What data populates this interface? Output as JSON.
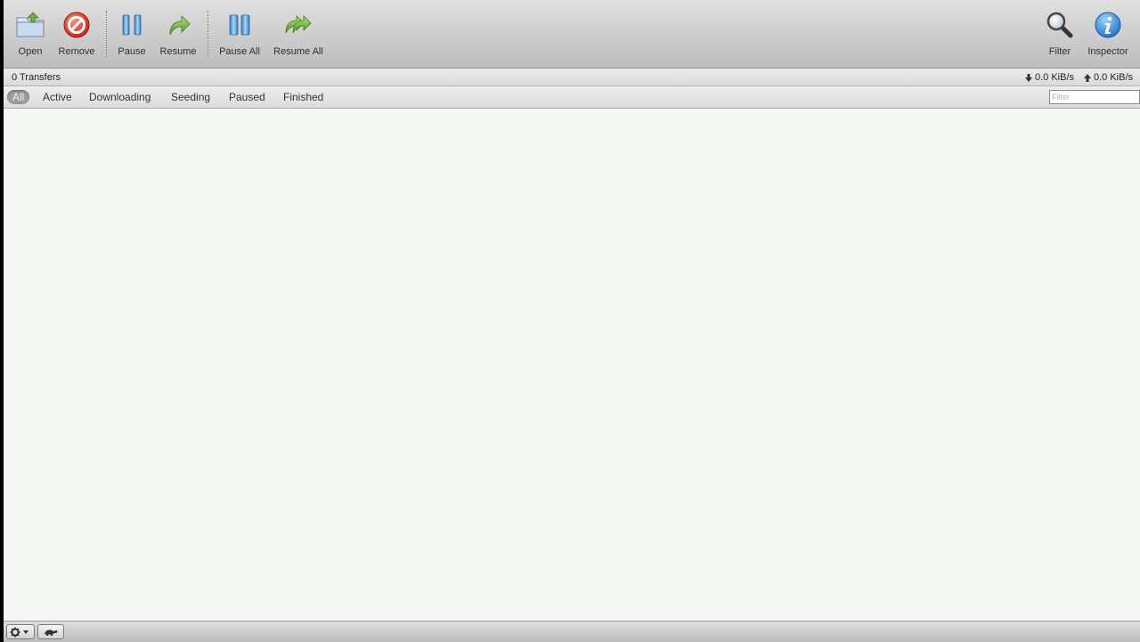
{
  "toolbar": {
    "open_label": "Open",
    "remove_label": "Remove",
    "pause_label": "Pause",
    "resume_label": "Resume",
    "pause_all_label": "Pause All",
    "resume_all_label": "Resume All",
    "filter_label": "Filter",
    "inspector_label": "Inspector"
  },
  "status": {
    "transfers": "0 Transfers",
    "download_speed": "0.0 KiB/s",
    "upload_speed": "0.0 KiB/s"
  },
  "filter_tabs": {
    "all": "All",
    "active": "Active",
    "downloading": "Downloading",
    "seeding": "Seeding",
    "paused": "Paused",
    "finished": "Finished",
    "selected": "All"
  },
  "filter": {
    "placeholder": "Filter",
    "value": ""
  },
  "icons": {
    "open": "folder-open-icon",
    "remove": "remove-icon",
    "pause": "pause-icon",
    "resume": "resume-icon",
    "filter": "magnifier-icon",
    "inspector": "info-icon",
    "settings": "gear-icon",
    "turtle": "turtle-icon"
  },
  "colors": {
    "remove_red": "#e53a2b",
    "pause_blue": "#5aa6e0",
    "resume_green": "#6db33f",
    "info_blue": "#2f8ad8",
    "list_background": "#f6f8f5"
  }
}
